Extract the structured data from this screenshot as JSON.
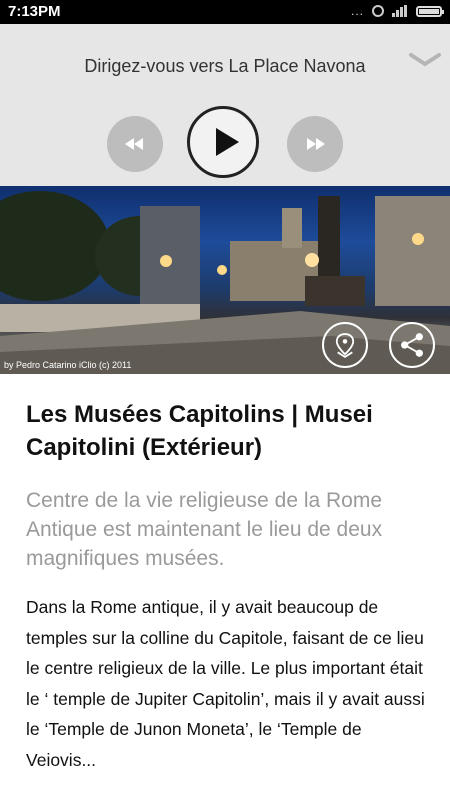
{
  "status_bar": {
    "time": "7:13PM",
    "dots": "..."
  },
  "player": {
    "title": "Dirigez-vous vers La Place Navona",
    "collapse_icon": "chevron-down-icon",
    "rewind_icon": "rewind-icon",
    "play_icon": "play-icon",
    "forward_icon": "fast-forward-icon"
  },
  "hero": {
    "credit": "by Pedro Catarino iClio (c) 2011",
    "map_icon": "map-pin-icon",
    "share_icon": "share-icon"
  },
  "article": {
    "title": "Les Musées Capitolins | Musei Capitolini (Extérieur)",
    "subtitle": "Centre de la vie religieuse de la Rome Antique est maintenant le lieu de deux magnifiques musées.",
    "body": "Dans la Rome antique, il y avait beaucoup de temples sur la colline du Capitole, faisant de ce lieu le centre religieux de la ville. Le plus important était le ‘ temple de Jupiter Capitolin’, mais il y avait aussi le ‘Temple de Junon Moneta’, le ‘Temple de Veiovis..."
  },
  "colors": {
    "player_bg": "#e6e6e6",
    "button_gray": "#bdbdbd",
    "subtitle_gray": "#9a9a9a",
    "text": "#111111"
  }
}
